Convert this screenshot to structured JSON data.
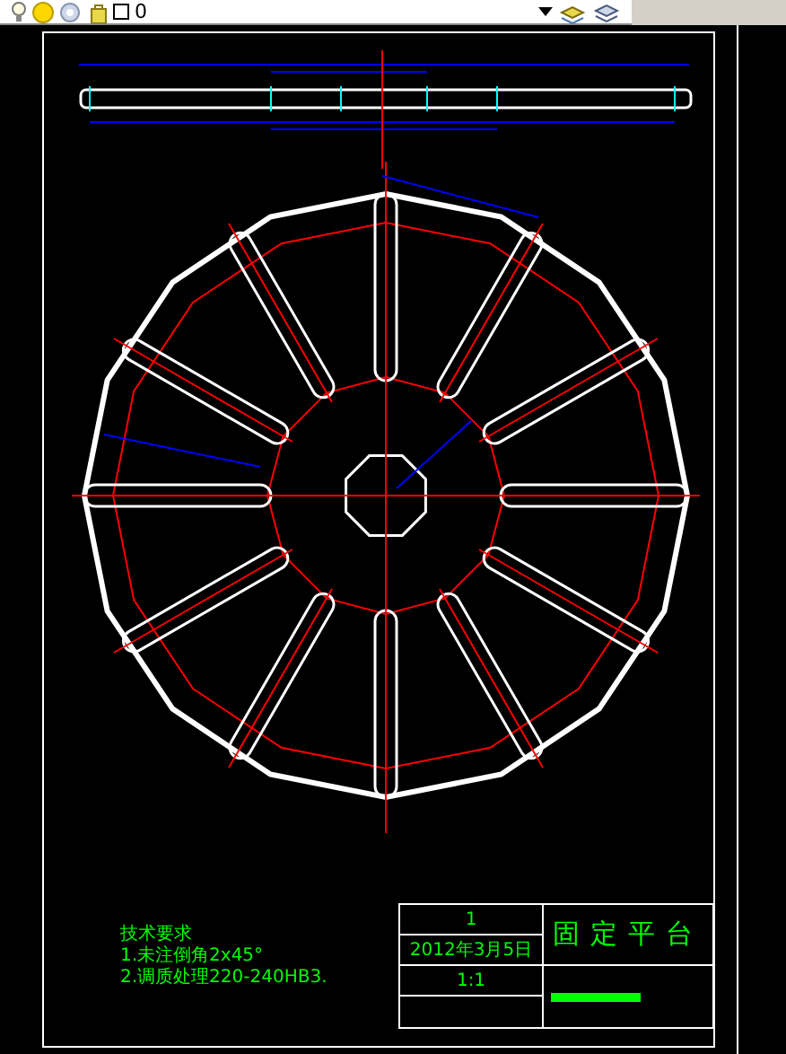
{
  "toolbar": {
    "layer": "0"
  },
  "notes": [
    "技术要求",
    "1.未注倒角2x45°",
    "2.调质处理220-240HB3."
  ],
  "title_block": {
    "quantity": "1",
    "date": "2012年3月5日",
    "scale": "1:1",
    "title": "固定平台"
  }
}
